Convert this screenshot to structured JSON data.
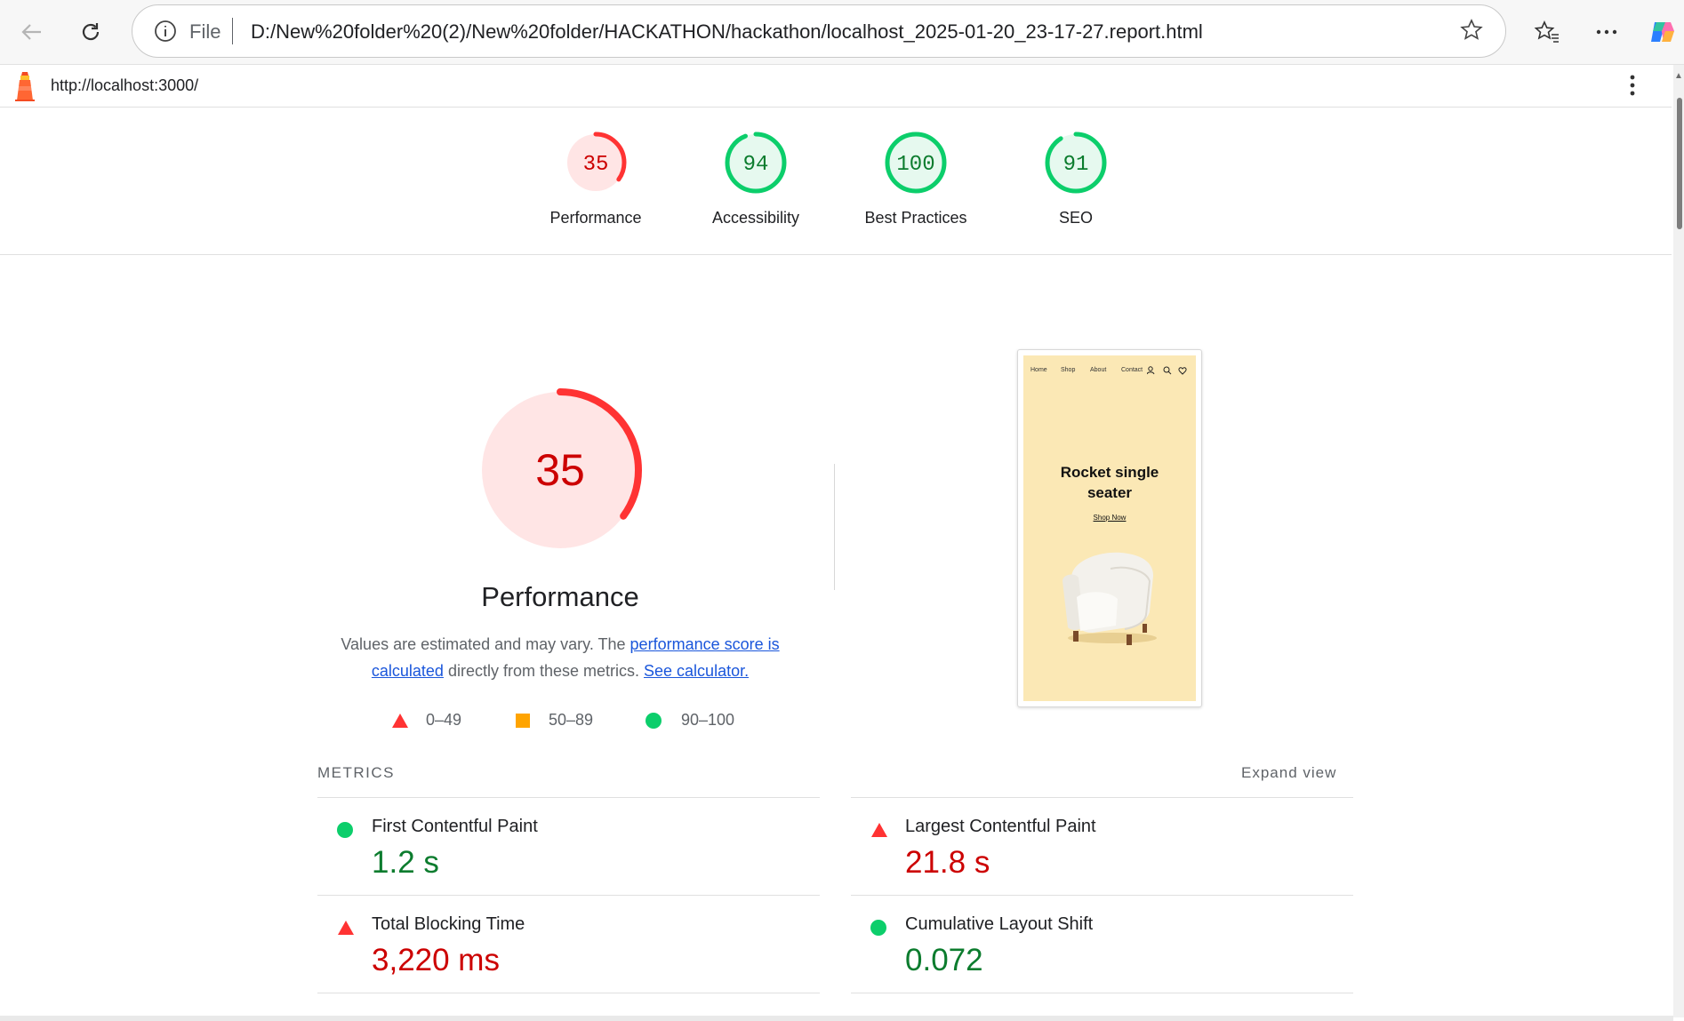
{
  "browser": {
    "file_label": "File",
    "address": "D:/New%20folder%20(2)/New%20folder/HACKATHON/hackathon/localhost_2025-01-20_23-17-27.report.html"
  },
  "lighthouse": {
    "url": "http://localhost:3000/"
  },
  "categories": [
    {
      "score": "35",
      "score_value": 35,
      "label": "Performance",
      "color": "#ff3333"
    },
    {
      "score": "94",
      "score_value": 94,
      "label": "Accessibility",
      "color": "#0cce6b"
    },
    {
      "score": "100",
      "score_value": 100,
      "label": "Best Practices",
      "color": "#0cce6b"
    },
    {
      "score": "91",
      "score_value": 91,
      "label": "SEO",
      "color": "#0cce6b"
    }
  ],
  "performance": {
    "score": "35",
    "score_value": 35,
    "title": "Performance",
    "desc_prefix": "Values are estimated and may vary. The ",
    "desc_link1": "performance score is calculated",
    "desc_middle": " directly from these metrics. ",
    "desc_link2": "See calculator.",
    "legend": [
      "0–49",
      "50–89",
      "90–100"
    ]
  },
  "screenshot": {
    "nav": [
      "Home",
      "Shop",
      "About",
      "Contact"
    ],
    "hero_line1": "Rocket single",
    "hero_line2": "seater",
    "cta": "Shop Now"
  },
  "metrics": {
    "header": "METRICS",
    "expand": "Expand view",
    "items": [
      {
        "name": "First Contentful Paint",
        "value": "1.2 s",
        "status": "pass"
      },
      {
        "name": "Largest Contentful Paint",
        "value": "21.8 s",
        "status": "fail"
      },
      {
        "name": "Total Blocking Time",
        "value": "3,220 ms",
        "status": "fail"
      },
      {
        "name": "Cumulative Layout Shift",
        "value": "0.072",
        "status": "pass"
      }
    ]
  },
  "colors": {
    "fail": "#ff3333",
    "average": "#ffa400",
    "pass": "#0cce6b"
  }
}
